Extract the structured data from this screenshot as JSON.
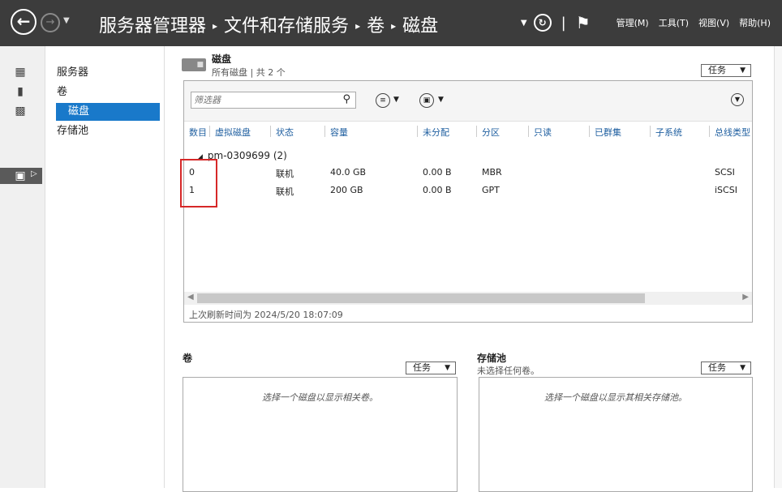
{
  "titlebar": {
    "breadcrumb": [
      "服务器管理器",
      "文件和存储服务",
      "卷",
      "磁盘"
    ],
    "menus": [
      "管理(M)",
      "工具(T)",
      "视图(V)",
      "帮助(H)"
    ]
  },
  "nav": {
    "items": [
      "服务器",
      "卷",
      "磁盘",
      "存储池"
    ],
    "selected": "磁盘"
  },
  "disks_section": {
    "title": "磁盘",
    "subtitle": "所有磁盘 | 共 2 个",
    "tasks_label": "任务",
    "filter_placeholder": "筛选器",
    "columns": [
      "数目",
      "虚拟磁盘",
      "状态",
      "容量",
      "未分配",
      "分区",
      "只读",
      "已群集",
      "子系统",
      "总线类型"
    ],
    "group": "pm-0309699 (2)",
    "rows": [
      {
        "number": "0",
        "status": "联机",
        "capacity": "40.0 GB",
        "unallocated": "0.00 B",
        "partition": "MBR",
        "bus": "SCSI"
      },
      {
        "number": "1",
        "status": "联机",
        "capacity": "200 GB",
        "unallocated": "0.00 B",
        "partition": "GPT",
        "bus": "iSCSI"
      }
    ],
    "last_refresh": "上次刷新时间为 2024/5/20 18:07:09"
  },
  "volumes_section": {
    "title": "卷",
    "tasks_label": "任务",
    "empty_message": "选择一个磁盘以显示相关卷。"
  },
  "pools_section": {
    "title": "存储池",
    "subtitle": "未选择任何卷。",
    "tasks_label": "任务",
    "empty_message": "选择一个磁盘以显示其相关存储池。"
  },
  "colors": {
    "titlebar": "#3c3c3c",
    "selection": "#1979ca",
    "highlight_box": "#d62828",
    "column_header": "#1f5fa0"
  }
}
